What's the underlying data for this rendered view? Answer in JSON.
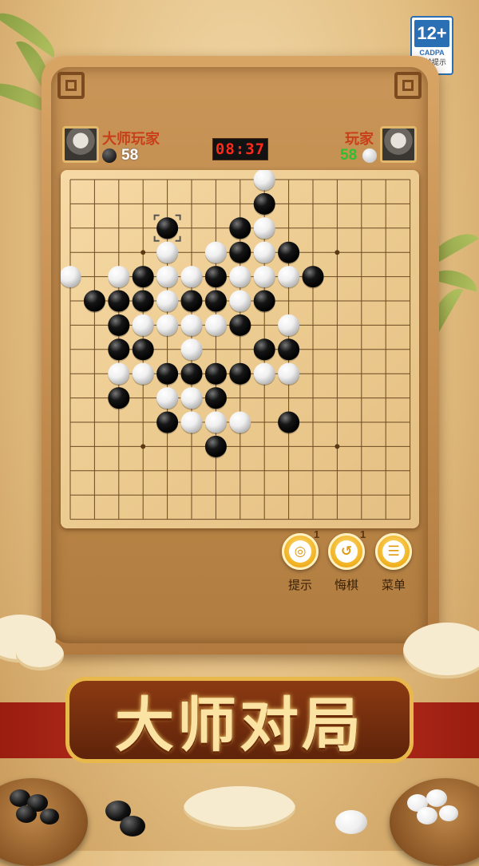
{
  "age_rating": {
    "label": "12+",
    "org": "CADPA",
    "tip": "适龄提示"
  },
  "players": {
    "left": {
      "name": "大师玩家",
      "stone": "black",
      "score": "58",
      "score_color": "#ffffff"
    },
    "right": {
      "name": "玩家",
      "stone": "white",
      "score": "58",
      "score_color": "#2fbf2f"
    }
  },
  "timer": "08:37",
  "board": {
    "size": 15,
    "star_points": [
      [
        3,
        3
      ],
      [
        3,
        11
      ],
      [
        11,
        3
      ],
      [
        11,
        11
      ]
    ],
    "last_move": [
      2,
      4
    ],
    "black": [
      [
        1,
        8
      ],
      [
        2,
        4
      ],
      [
        2,
        7
      ],
      [
        3,
        7
      ],
      [
        3,
        9
      ],
      [
        4,
        3
      ],
      [
        4,
        6
      ],
      [
        4,
        10
      ],
      [
        5,
        1
      ],
      [
        5,
        2
      ],
      [
        5,
        3
      ],
      [
        5,
        5
      ],
      [
        5,
        6
      ],
      [
        5,
        8
      ],
      [
        6,
        2
      ],
      [
        6,
        7
      ],
      [
        7,
        2
      ],
      [
        7,
        3
      ],
      [
        7,
        8
      ],
      [
        7,
        9
      ],
      [
        8,
        4
      ],
      [
        8,
        5
      ],
      [
        8,
        6
      ],
      [
        8,
        7
      ],
      [
        9,
        2
      ],
      [
        9,
        6
      ],
      [
        10,
        4
      ],
      [
        10,
        9
      ],
      [
        11,
        6
      ]
    ],
    "white": [
      [
        0,
        8
      ],
      [
        2,
        8
      ],
      [
        3,
        4
      ],
      [
        3,
        6
      ],
      [
        3,
        8
      ],
      [
        4,
        0
      ],
      [
        4,
        2
      ],
      [
        4,
        4
      ],
      [
        4,
        5
      ],
      [
        4,
        7
      ],
      [
        4,
        8
      ],
      [
        4,
        9
      ],
      [
        5,
        4
      ],
      [
        5,
        7
      ],
      [
        6,
        3
      ],
      [
        6,
        4
      ],
      [
        6,
        5
      ],
      [
        6,
        6
      ],
      [
        6,
        9
      ],
      [
        7,
        5
      ],
      [
        8,
        2
      ],
      [
        8,
        3
      ],
      [
        8,
        8
      ],
      [
        8,
        9
      ],
      [
        9,
        4
      ],
      [
        9,
        5
      ],
      [
        10,
        5
      ],
      [
        10,
        6
      ],
      [
        10,
        7
      ]
    ]
  },
  "controls": [
    {
      "id": "hint",
      "label": "提示",
      "count": "1",
      "icon": "lightbulb-icon",
      "glyph": "◎"
    },
    {
      "id": "undo",
      "label": "悔棋",
      "count": "1",
      "icon": "undo-icon",
      "glyph": "↺"
    },
    {
      "id": "menu",
      "label": "菜单",
      "count": "",
      "icon": "menu-list-icon",
      "glyph": "☰"
    }
  ],
  "banner_title": "大师对局",
  "colors": {
    "timer_red": "#ff2a1a",
    "name_red": "#c7401a",
    "button_gold": "#f0b020"
  }
}
